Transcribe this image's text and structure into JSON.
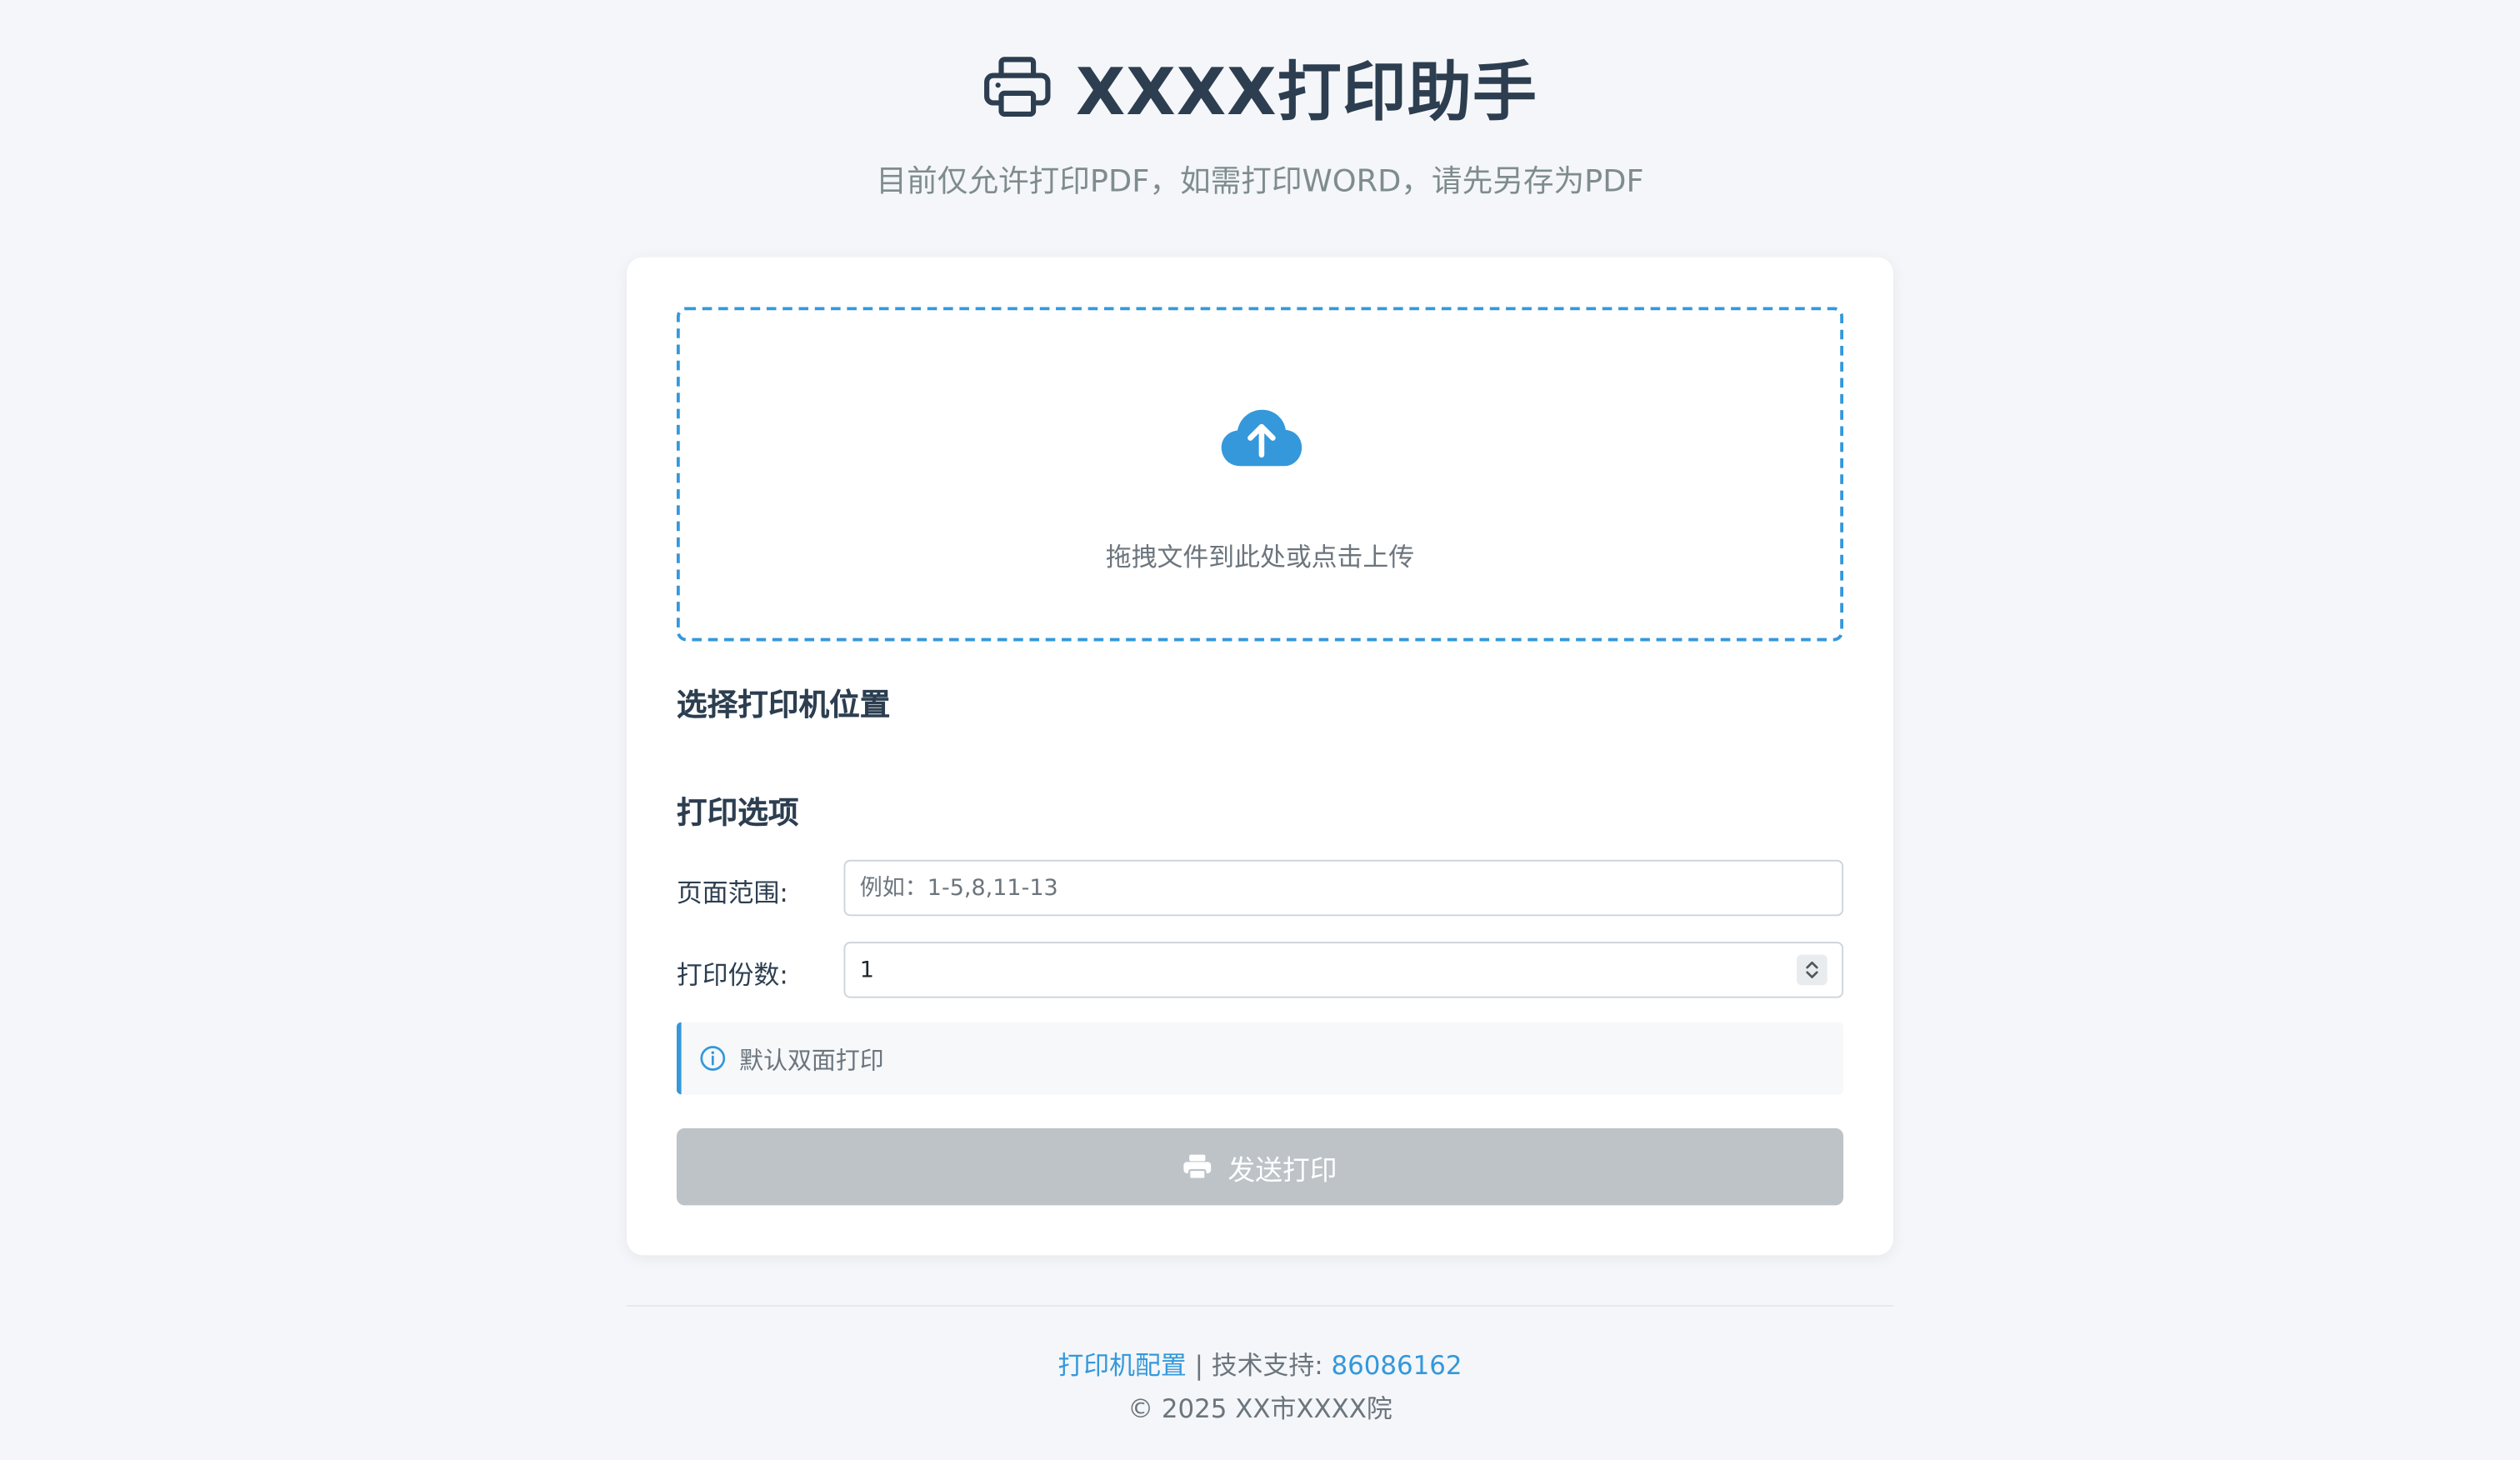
{
  "header": {
    "icon": "printer-icon",
    "title": "XXXX打印助手",
    "subtitle": "目前仅允许打印PDF，如需打印WORD，请先另存为PDF"
  },
  "upload": {
    "icon": "cloud-upload-icon",
    "hint": "拖拽文件到此处或点击上传"
  },
  "printer_location": {
    "title": "选择打印机位置"
  },
  "print_options": {
    "title": "打印选项",
    "page_range": {
      "label": "页面范围:",
      "value": "",
      "placeholder": "例如：1-5,8,11-13"
    },
    "copies": {
      "label": "打印份数:",
      "value": "1"
    },
    "notice": {
      "icon": "info-icon",
      "text": "默认双面打印"
    }
  },
  "submit": {
    "icon": "printer-icon",
    "label": "发送打印",
    "disabled": true
  },
  "footer": {
    "config_link": "打印机配置",
    "separator": "|",
    "support_label": "技术支持:",
    "support_phone": "86086162",
    "copyright": "© 2025 XX市XXXX院"
  },
  "colors": {
    "accent": "#3498db",
    "title": "#2c3e50",
    "muted": "#7f8c8d",
    "button_disabled": "#bdc3c7",
    "page_bg": "#f4f6f9"
  }
}
